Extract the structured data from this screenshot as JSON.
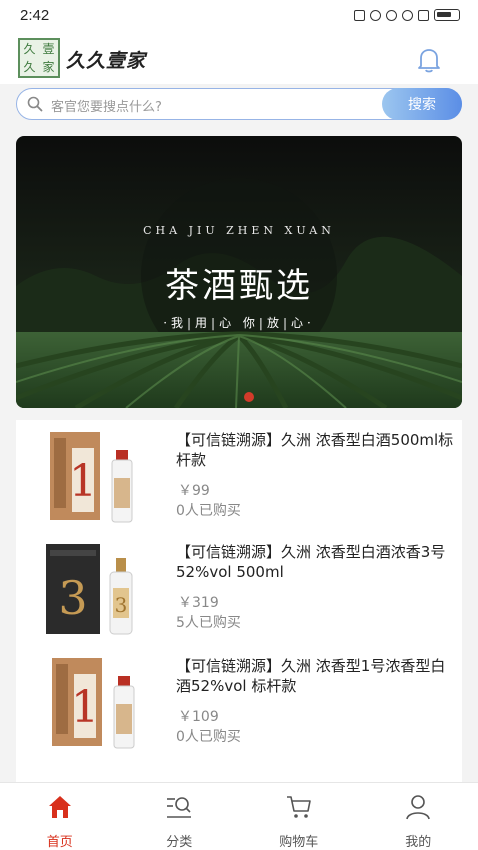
{
  "status_bar": {
    "time": "2:42"
  },
  "header": {
    "logo_chars": [
      "久",
      "壹",
      "久",
      "家"
    ],
    "title": "久久壹家"
  },
  "search": {
    "placeholder": "客官您要搜点什么?",
    "button_label": "搜索"
  },
  "banner": {
    "subtitle": "CHA JIU ZHEN XUAN",
    "title": "茶酒甄选",
    "slogan": "·我|用|心 你|放|心·"
  },
  "products": [
    {
      "title": "【可信链溯源】久洲 浓香型白酒500ml标杆款",
      "price": "￥99",
      "sold": "0人已购买",
      "box_number": "1",
      "box_color": "#b78355"
    },
    {
      "title": "【可信链溯源】久洲 浓香型白酒浓香3号 52%vol 500ml",
      "price": "￥319",
      "sold": "5人已购买",
      "box_number": "3",
      "box_color": "#2b2b2b"
    },
    {
      "title": "【可信链溯源】久洲 浓香型1号浓香型白酒52%vol 标杆款",
      "price": "￥109",
      "sold": "0人已购买",
      "box_number": "1",
      "box_color": "#b78355"
    }
  ],
  "tabs": [
    {
      "label": "首页",
      "icon": "home-icon",
      "active": true
    },
    {
      "label": "分类",
      "icon": "category-search-icon",
      "active": false
    },
    {
      "label": "购物车",
      "icon": "cart-icon",
      "active": false
    },
    {
      "label": "我的",
      "icon": "user-icon",
      "active": false
    }
  ],
  "colors": {
    "accent": "#d8301c",
    "search_button": "#5b8ee6",
    "brand_green": "#5c8f5c"
  }
}
